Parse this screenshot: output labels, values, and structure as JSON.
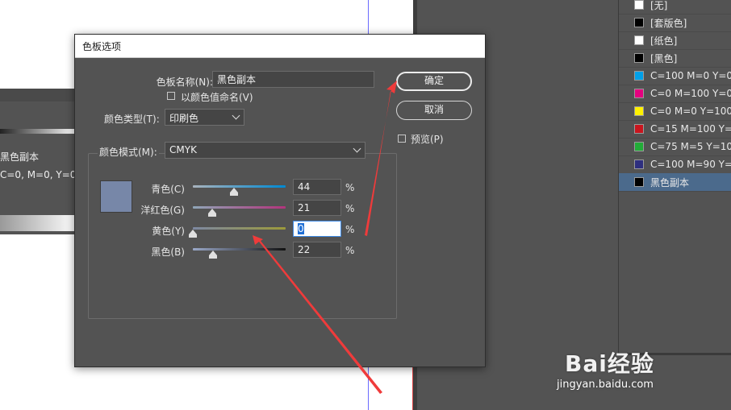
{
  "swatches": [
    {
      "name": "[无]",
      "color": "#ffffff"
    },
    {
      "name": "[套版色]",
      "color": "#000000"
    },
    {
      "name": "[纸色]",
      "color": "#ffffff"
    },
    {
      "name": "[黑色]",
      "color": "#000000"
    },
    {
      "name": "C=100 M=0 Y=0",
      "color": "#00a0e9"
    },
    {
      "name": "C=0 M=100 Y=0",
      "color": "#e4007f"
    },
    {
      "name": "C=0 M=0 Y=100",
      "color": "#fff100"
    },
    {
      "name": "C=15 M=100 Y=",
      "color": "#c9151e"
    },
    {
      "name": "C=75 M=5 Y=10",
      "color": "#22ac38"
    },
    {
      "name": "C=100 M=90 Y=",
      "color": "#2e2f7f"
    },
    {
      "name": "黑色副本",
      "color": "#000000",
      "selected": true
    }
  ],
  "background_panel": {
    "swatch_name": "黑色副本",
    "values_text": "C=0, M=0, Y=0,"
  },
  "dialog": {
    "title": "色板选项",
    "swatch_name_label": "色板名称(N):",
    "swatch_name_value": "黑色副本",
    "name_by_value_label": "以颜色值命名(V)",
    "color_type_label": "颜色类型(T):",
    "color_type_value": "印刷色",
    "color_mode_label": "颜色模式(M):",
    "color_mode_value": "CMYK",
    "ok_label": "确定",
    "cancel_label": "取消",
    "preview_label": "预览(P)",
    "preview_color": "#7787a8",
    "percent": "%",
    "sliders": [
      {
        "label": "青色(C)",
        "value": "44",
        "level": 0.44
      },
      {
        "label": "洋红色(G)",
        "value": "21",
        "level": 0.21
      },
      {
        "label": "黄色(Y)",
        "value": "0",
        "level": 0.0,
        "focused": true
      },
      {
        "label": "黑色(B)",
        "value": "22",
        "level": 0.22
      }
    ]
  },
  "watermark": {
    "brand": "Bai经验",
    "url": "jingyan.baidu.com"
  }
}
